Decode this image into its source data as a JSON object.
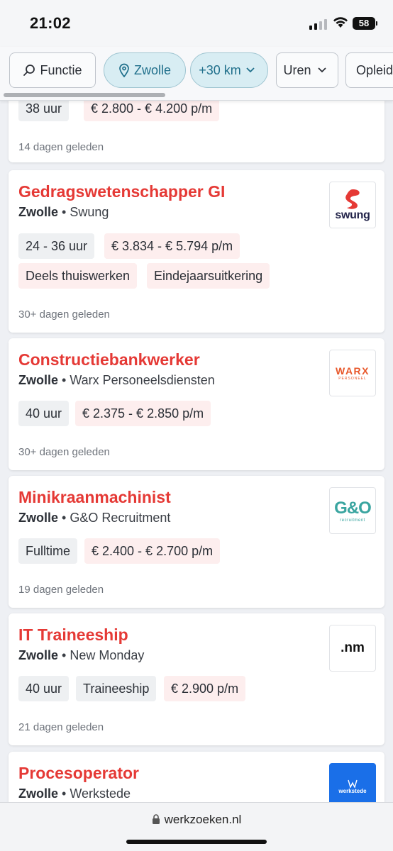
{
  "status": {
    "time": "21:02",
    "battery": "58"
  },
  "filters": {
    "function_label": "Functie",
    "location_label": "Zwolle",
    "distance_label": "+30 km",
    "hours_label": "Uren",
    "education_label": "Opleiding"
  },
  "partial_card": {
    "tags": [
      "38 uur",
      "€ 2.800 - € 4.200 p/m"
    ],
    "date": "14 dagen geleden"
  },
  "jobs": [
    {
      "title": "Gedragswetenschapper GI",
      "location": "Zwolle",
      "company": "Swung",
      "tags_row1": [
        "24 - 36 uur",
        "€ 3.834 - € 5.794 p/m"
      ],
      "tags_row2": [
        "Deels thuiswerken",
        "Eindejaarsuitkering"
      ],
      "date": "30+ dagen geleden",
      "logo_text": "swung"
    },
    {
      "title": "Constructiebankwerker",
      "location": "Zwolle",
      "company": "Warx Personeelsdiensten",
      "tags_row1": [
        "40 uur",
        "€ 2.375 - € 2.850 p/m"
      ],
      "date": "30+ dagen geleden",
      "logo_text": "WARX",
      "logo_subtext": "PERSONEEL"
    },
    {
      "title": "Minikraanmachinist",
      "location": "Zwolle",
      "company": "G&O Recruitment",
      "tags_row1": [
        "Fulltime",
        "€ 2.400 - € 2.700 p/m"
      ],
      "date": "19 dagen geleden",
      "logo_text": "G&O",
      "logo_subtext": "recruitment"
    },
    {
      "title": "IT Traineeship",
      "location": "Zwolle",
      "company": "New Monday",
      "tags_row1": [
        "40 uur",
        "Traineeship",
        "€ 2.900 p/m"
      ],
      "date": "21 dagen geleden",
      "logo_text": ".nm"
    },
    {
      "title": "Procesoperator",
      "location": "Zwolle",
      "company": "Werkstede",
      "logo_text": "werkstede"
    }
  ],
  "browser": {
    "url": "werkzoeken.nl"
  },
  "colors": {
    "title_red": "#e53935",
    "chip_blue": "#d8edf3",
    "salary_tag": "#fdeeee",
    "hours_tag": "#eef0f2"
  }
}
